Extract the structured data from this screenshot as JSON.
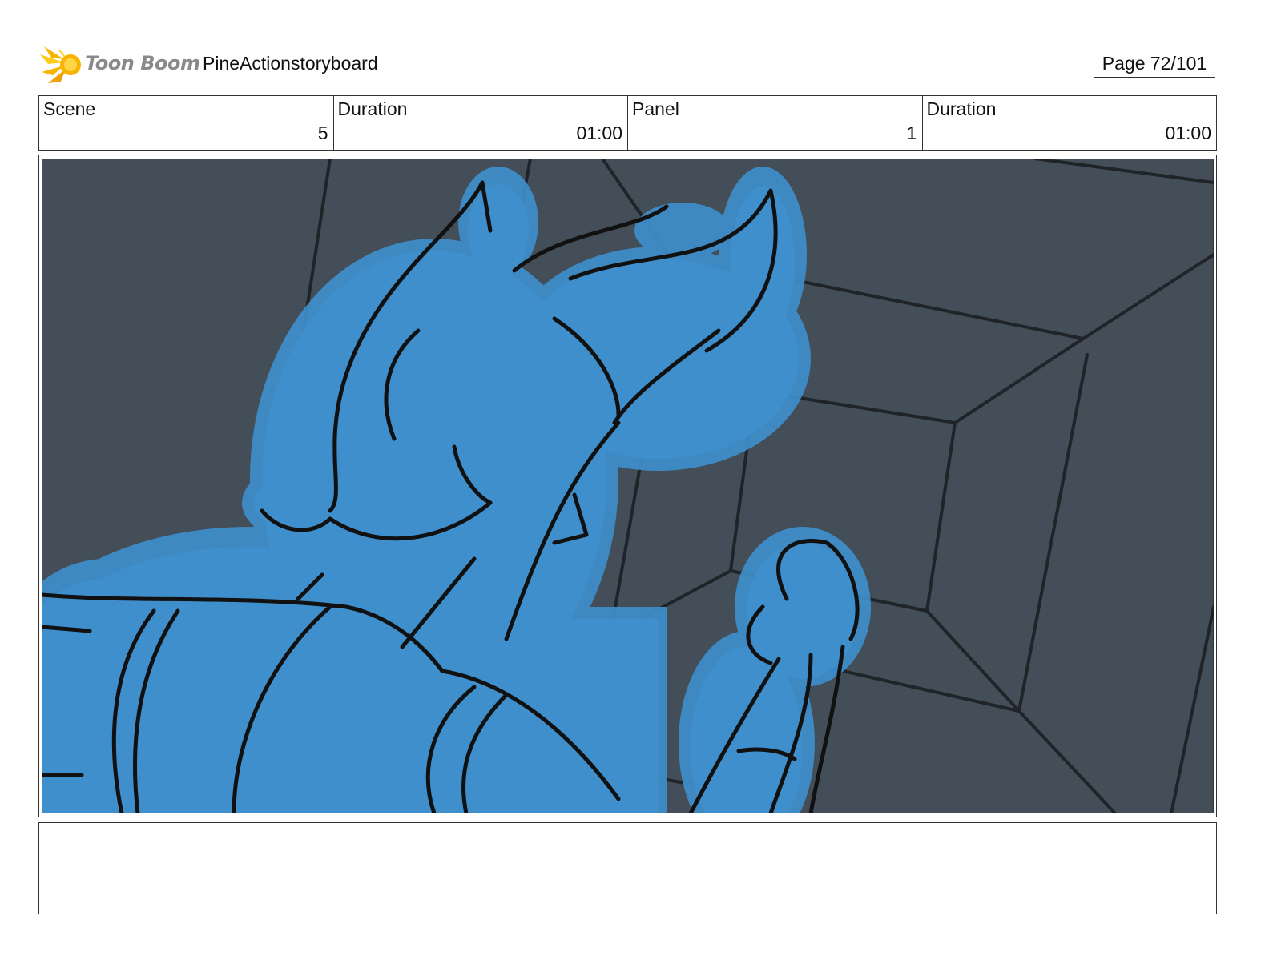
{
  "header": {
    "logo_text": "Toon Boom",
    "title": "PineActionstoryboard",
    "page_label": "Page  72/101"
  },
  "info": {
    "scene_label": "Scene",
    "scene_value": "5",
    "scene_duration_label": "Duration",
    "scene_duration_value": "01:00",
    "panel_label": "Panel",
    "panel_value": "1",
    "panel_duration_label": "Duration",
    "panel_duration_value": "01:00"
  },
  "panel": {
    "background_color": "#434e59",
    "character_fill_color": "#3f8fcc",
    "line_color": "#111111",
    "grid_line_color": "#1f2428"
  },
  "notes": {
    "text": ""
  }
}
